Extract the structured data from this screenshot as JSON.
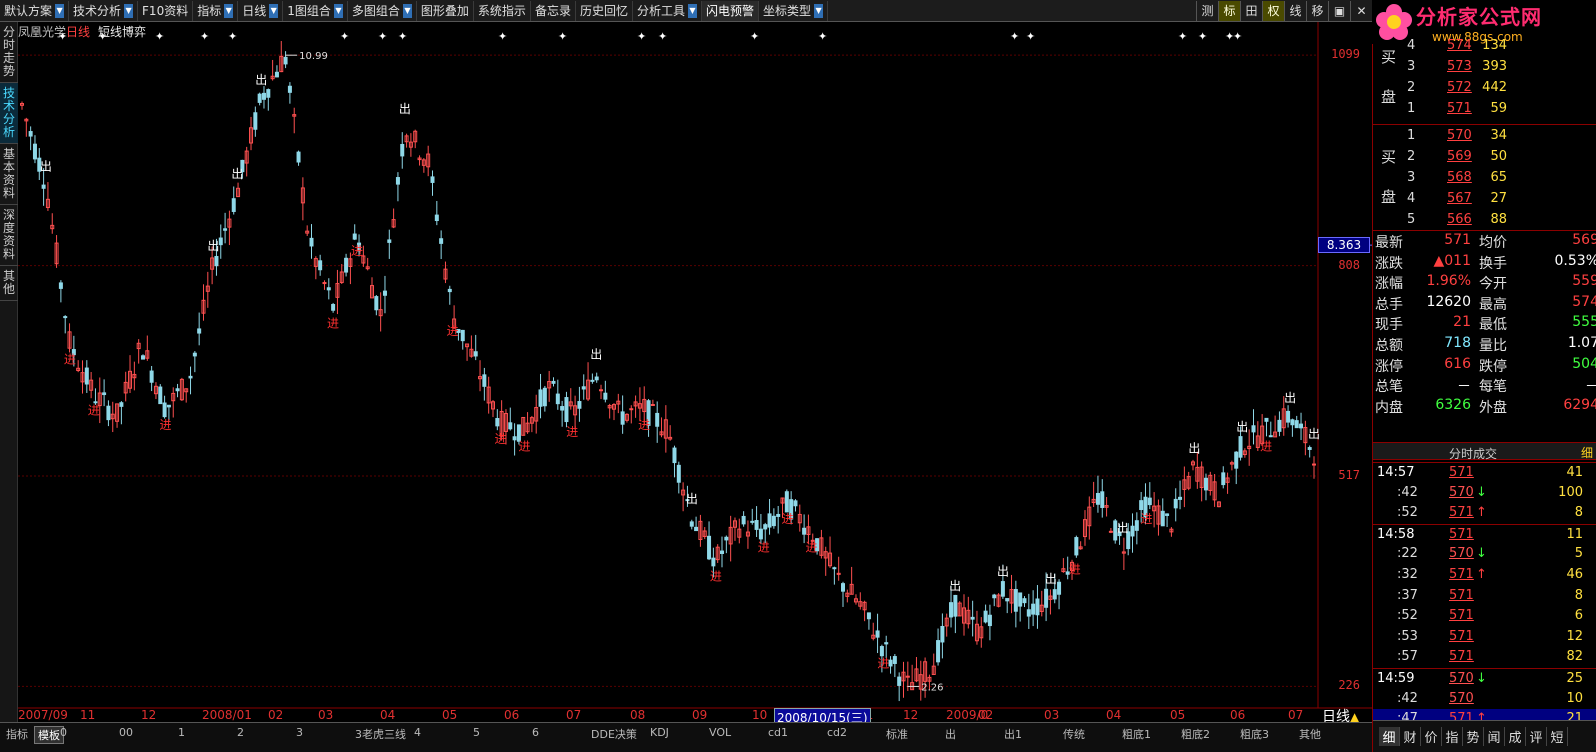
{
  "toolbar": {
    "buttons": [
      {
        "label": "默认方案",
        "dd": true
      },
      {
        "label": "技术分析",
        "dd": true
      },
      {
        "label": "F10资料",
        "dd": false
      },
      {
        "label": "指标",
        "dd": true
      },
      {
        "label": "日线",
        "dd": true
      },
      {
        "label": "1图组合",
        "dd": true
      },
      {
        "label": "多图组合",
        "dd": true
      },
      {
        "label": "图形叠加",
        "dd": false
      },
      {
        "label": "系统指示",
        "dd": false
      },
      {
        "label": "备忘录",
        "dd": false
      },
      {
        "label": "历史回忆",
        "dd": false
      },
      {
        "label": "分析工具",
        "dd": true
      },
      {
        "label": "闪电预警",
        "dd": false
      },
      {
        "label": "坐标类型",
        "dd": true
      }
    ],
    "right_buttons": [
      {
        "label": "测",
        "on": false
      },
      {
        "label": "标",
        "on": true
      },
      {
        "label": "田",
        "on": false
      },
      {
        "label": "权",
        "on": true
      },
      {
        "label": "线",
        "on": false
      },
      {
        "label": "移",
        "on": false
      },
      {
        "label": "▣",
        "on": false
      },
      {
        "label": "✕",
        "on": false
      }
    ]
  },
  "logo": {
    "title": "分析家公式网",
    "url_text": "www.88gs.com"
  },
  "side_tabs": [
    {
      "label": "分时走势",
      "on": false
    },
    {
      "label": "技术分析",
      "on": true
    },
    {
      "label": "基本资料",
      "on": false
    },
    {
      "label": "深度资料",
      "on": false
    },
    {
      "label": "其他",
      "on": false
    }
  ],
  "chart_title": {
    "stock": "凤凰光学",
    "period": "日线",
    "indicator": "短线博弈"
  },
  "chart_data": {
    "type": "candlestick",
    "stock": "凤凰光学",
    "period": "日线",
    "y_axis_ticks": [
      {
        "label": "1099",
        "value": 10.99
      },
      {
        "label": "808",
        "value": 8.08
      },
      {
        "label": "517",
        "value": 5.17
      },
      {
        "label": "226",
        "value": 2.26
      }
    ],
    "current_value_label": "8.363",
    "current_value": 8.363,
    "annotations": [
      {
        "text": "10.99",
        "value": 10.99
      },
      {
        "text": "2.26",
        "value": 2.26
      }
    ],
    "selected_date": "2008/10/15(三)",
    "x_tick_labels": [
      "2007/09",
      "11",
      "12",
      "2008/01",
      "02",
      "03",
      "04",
      "05",
      "06",
      "07",
      "08",
      "09",
      "10",
      "11",
      "12",
      "2009/0",
      "02",
      "03",
      "04",
      "05",
      "06",
      "07"
    ],
    "trend_values": [
      10.3,
      9.2,
      7.0,
      6.3,
      6.0,
      7.0,
      6.1,
      6.5,
      8.1,
      9.1,
      10.4,
      10.99,
      8.4,
      7.5,
      8.5,
      7.4,
      10.0,
      9.5,
      7.4,
      6.7,
      5.9,
      5.8,
      6.4,
      6.0,
      6.6,
      6.0,
      6.1,
      5.8,
      4.6,
      4.0,
      4.5,
      4.4,
      4.8,
      4.4,
      3.8,
      3.4,
      2.8,
      2.26,
      2.5,
      3.4,
      3.0,
      3.6,
      3.3,
      3.5,
      4.1,
      4.9,
      4.2,
      4.8,
      4.5,
      5.3,
      4.9,
      5.6,
      5.8,
      6.0,
      5.5
    ],
    "signals": [
      {
        "t": "出",
        "i": 1
      },
      {
        "t": "进",
        "i": 2
      },
      {
        "t": "进",
        "i": 3
      },
      {
        "t": "进",
        "i": 6
      },
      {
        "t": "出",
        "i": 8
      },
      {
        "t": "出",
        "i": 9
      },
      {
        "t": "出",
        "i": 10
      },
      {
        "t": "进",
        "i": 13
      },
      {
        "t": "进",
        "i": 14
      },
      {
        "t": "出",
        "i": 16
      },
      {
        "t": "进",
        "i": 18
      },
      {
        "t": "进",
        "i": 20
      },
      {
        "t": "进",
        "i": 21
      },
      {
        "t": "进",
        "i": 23
      },
      {
        "t": "出",
        "i": 24
      },
      {
        "t": "进",
        "i": 26
      },
      {
        "t": "出",
        "i": 28
      },
      {
        "t": "进",
        "i": 29
      },
      {
        "t": "进",
        "i": 31
      },
      {
        "t": "进",
        "i": 32
      },
      {
        "t": "进",
        "i": 33
      },
      {
        "t": "进",
        "i": 36
      },
      {
        "t": "出",
        "i": 39
      },
      {
        "t": "出",
        "i": 41
      },
      {
        "t": "出",
        "i": 43
      },
      {
        "t": "进",
        "i": 44
      },
      {
        "t": "出",
        "i": 46
      },
      {
        "t": "进",
        "i": 47
      },
      {
        "t": "出",
        "i": 49
      },
      {
        "t": "出",
        "i": 51
      },
      {
        "t": "进",
        "i": 52
      },
      {
        "t": "出",
        "i": 53
      },
      {
        "t": "出",
        "i": 54
      }
    ]
  },
  "bottom_tabs": [
    "指标",
    "模板",
    "0",
    "00",
    "1",
    "2",
    "3",
    "3老虎三线",
    "4",
    "5",
    "6",
    "DDE决策",
    "KDJ",
    "VOL",
    "cd1",
    "cd2",
    "标准",
    "出",
    "出1",
    "传统",
    "粗底1",
    "粗底2",
    "粗底3",
    "其他"
  ],
  "period_label": "日线",
  "quotes": {
    "sell": [
      {
        "lvl": "4",
        "price": "574",
        "vol": "134"
      },
      {
        "lvl": "3",
        "price": "573",
        "vol": "393"
      },
      {
        "lvl": "2",
        "price": "572",
        "vol": "442"
      },
      {
        "lvl": "1",
        "price": "571",
        "vol": "59"
      }
    ],
    "buy": [
      {
        "lvl": "1",
        "price": "570",
        "vol": "34"
      },
      {
        "lvl": "2",
        "price": "569",
        "vol": "50"
      },
      {
        "lvl": "3",
        "price": "568",
        "vol": "65"
      },
      {
        "lvl": "4",
        "price": "567",
        "vol": "27"
      },
      {
        "lvl": "5",
        "price": "566",
        "vol": "88"
      }
    ],
    "sell_label": [
      "买",
      "盘"
    ],
    "buy_label": [
      "买",
      "盘"
    ]
  },
  "stats": [
    {
      "k1": "最新",
      "v1": "571",
      "c1": "#ff4040",
      "k2": "均价",
      "v2": "569",
      "c2": "#ff4040"
    },
    {
      "k1": "涨跌",
      "v1": "▲011",
      "c1": "#ff4040",
      "k2": "换手",
      "v2": "0.53%",
      "c2": "#ffffff"
    },
    {
      "k1": "涨幅",
      "v1": "1.96%",
      "c1": "#ff4040",
      "k2": "今开",
      "v2": "559",
      "c2": "#ff4040"
    },
    {
      "k1": "总手",
      "v1": "12620",
      "c1": "#ffffff",
      "k2": "最高",
      "v2": "574",
      "c2": "#ff4040"
    },
    {
      "k1": "现手",
      "v1": "21",
      "c1": "#ff4040",
      "k2": "最低",
      "v2": "555",
      "c2": "#40ff40"
    },
    {
      "k1": "总额",
      "v1": "718",
      "c1": "#80e8ff",
      "k2": "量比",
      "v2": "1.07",
      "c2": "#ffffff"
    },
    {
      "k1": "涨停",
      "v1": "616",
      "c1": "#ff4040",
      "k2": "跌停",
      "v2": "504",
      "c2": "#40ff40"
    },
    {
      "k1": "总笔",
      "v1": "－",
      "c1": "#ffffff",
      "k2": "每笔",
      "v2": "－",
      "c2": "#ffffff"
    },
    {
      "k1": "内盘",
      "v1": "6326",
      "c1": "#40ff40",
      "k2": "外盘",
      "v2": "6294",
      "c2": "#ff4040"
    }
  ],
  "ticks_header": {
    "title": "分时成交",
    "detail": "细"
  },
  "ticks": [
    {
      "time": "14:57",
      "price": "571",
      "arrow": "",
      "vol": "41",
      "big": true
    },
    {
      "time": ":42",
      "price": "570",
      "arrow": "down",
      "vol": "100",
      "big": false
    },
    {
      "time": ":52",
      "price": "571",
      "arrow": "up",
      "vol": "8",
      "big": false
    },
    {
      "time": "14:58",
      "price": "571",
      "arrow": "",
      "vol": "11",
      "big": true
    },
    {
      "time": ":22",
      "price": "570",
      "arrow": "down",
      "vol": "5",
      "big": false
    },
    {
      "time": ":32",
      "price": "571",
      "arrow": "up",
      "vol": "46",
      "big": false
    },
    {
      "time": ":37",
      "price": "571",
      "arrow": "",
      "vol": "8",
      "big": false
    },
    {
      "time": ":52",
      "price": "571",
      "arrow": "",
      "vol": "6",
      "big": false
    },
    {
      "time": ":53",
      "price": "571",
      "arrow": "",
      "vol": "12",
      "big": false
    },
    {
      "time": ":57",
      "price": "571",
      "arrow": "",
      "vol": "82",
      "big": false
    },
    {
      "time": "14:59",
      "price": "570",
      "arrow": "down",
      "vol": "25",
      "big": true
    },
    {
      "time": ":42",
      "price": "570",
      "arrow": "",
      "vol": "10",
      "big": false
    },
    {
      "time": ":47",
      "price": "571",
      "arrow": "up",
      "vol": "21",
      "big": false
    }
  ],
  "right_bottom_tabs": [
    "细",
    "财",
    "价",
    "指",
    "势",
    "闻",
    "成",
    "评",
    "短"
  ]
}
